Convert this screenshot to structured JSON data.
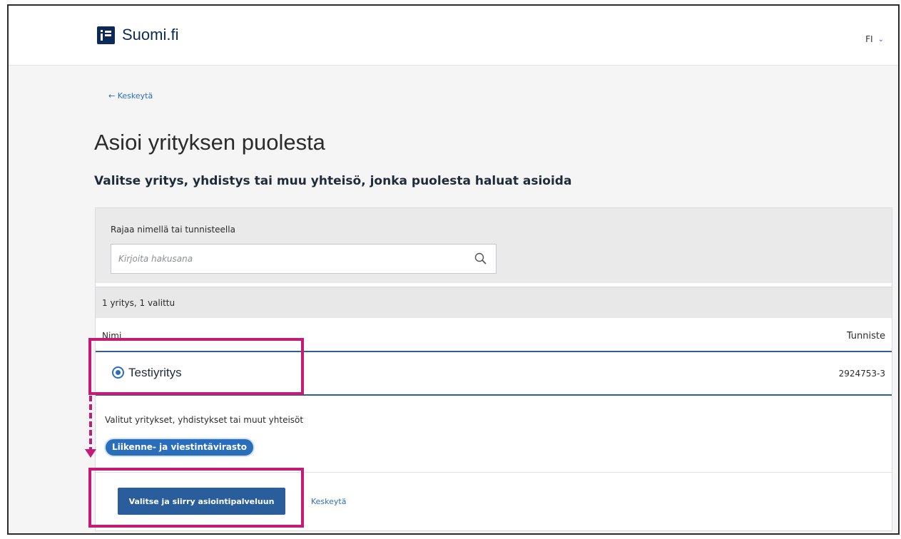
{
  "header": {
    "logo_text": "Suomi.fi",
    "language": "FI",
    "language_chevron": "⌄"
  },
  "nav": {
    "back_arrow": "←",
    "back_label": "Keskeytä"
  },
  "page": {
    "title": "Asioi yrityksen puolesta",
    "subtitle": "Valitse yritys, yhdistys tai muu yhteisö, jonka puolesta haluat asioida"
  },
  "filter": {
    "label": "Rajaa nimellä tai tunnisteella",
    "placeholder": "Kirjoita hakusana",
    "value": ""
  },
  "results": {
    "count_text": "1 yritys, 1 valittu",
    "columns": [
      "Nimi",
      "Tunniste"
    ],
    "rows": [
      {
        "name": "Testiyritys",
        "id": "2924753-3",
        "selected": true
      }
    ]
  },
  "selected": {
    "label": "Valitut yritykset, yhdistykset tai muut yhteisöt",
    "chips": [
      "Liikenne- ja viestintävirasto"
    ]
  },
  "actions": {
    "primary_label": "Valitse ja siirry asiointipalveluun",
    "cancel_label": "Keskeytä"
  },
  "colors": {
    "accent": "#2a6ebb",
    "brand": "#0b2a5a",
    "highlight": "#c41a78",
    "button": "#2a5d9c"
  },
  "icons": {
    "search": "search-icon",
    "logo": "suomi-fi-logo-icon",
    "back": "arrow-left-icon",
    "language": "chevron-down-icon"
  }
}
